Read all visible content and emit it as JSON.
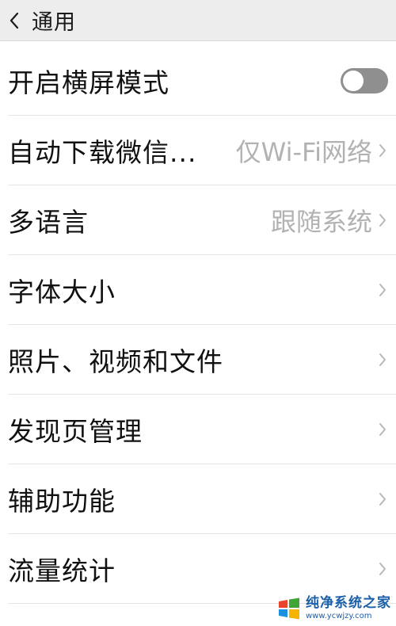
{
  "header": {
    "title": "通用",
    "back_icon": "chevron-left-icon"
  },
  "settings": [
    {
      "id": "landscape",
      "label": "开启横屏模式",
      "control": "toggle",
      "enabled": false
    },
    {
      "id": "auto-download",
      "label": "自动下载微信...",
      "value": "仅Wi-Fi网络",
      "control": "chevron"
    },
    {
      "id": "language",
      "label": "多语言",
      "value": "跟随系统",
      "control": "chevron"
    },
    {
      "id": "font-size",
      "label": "字体大小",
      "control": "chevron"
    },
    {
      "id": "media",
      "label": "照片、视频和文件",
      "control": "chevron"
    },
    {
      "id": "discover",
      "label": "发现页管理",
      "control": "chevron"
    },
    {
      "id": "accessibility",
      "label": "辅助功能",
      "control": "chevron"
    },
    {
      "id": "traffic",
      "label": "流量统计",
      "control": "chevron"
    }
  ],
  "watermark": {
    "title": "纯净系统之家",
    "url": "www.ycwjzy.com"
  },
  "colors": {
    "header_bg": "#ededed",
    "value_text": "#b2b2b2",
    "toggle_off": "#8f8f8f",
    "watermark": "#1b5fa8"
  }
}
